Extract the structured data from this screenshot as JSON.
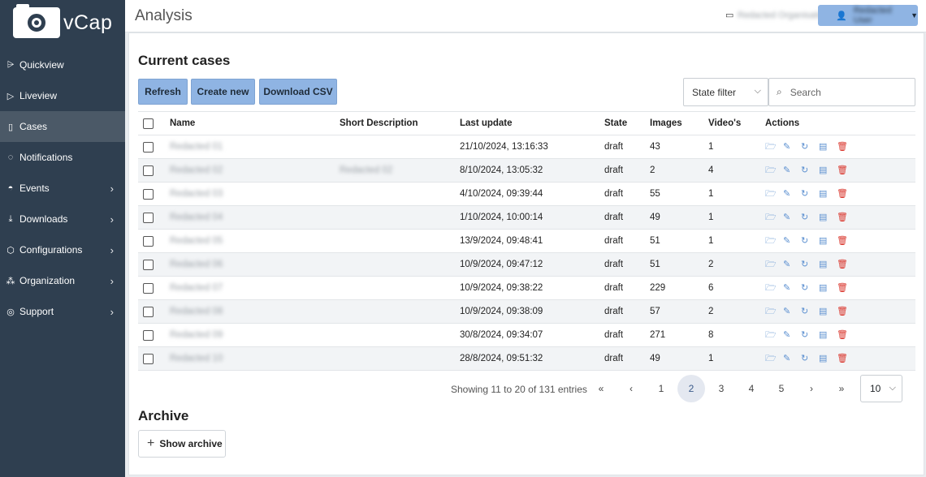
{
  "app": {
    "logo_text": "vCap"
  },
  "sidebar": {
    "items": [
      {
        "label": "Quickview",
        "icon": "⩥"
      },
      {
        "label": "Liveview",
        "icon": "▷"
      },
      {
        "label": "Cases",
        "icon": "▯"
      },
      {
        "label": "Notifications",
        "icon": "◌"
      },
      {
        "label": "Events",
        "icon": "◓"
      },
      {
        "label": "Downloads",
        "icon": "⤓"
      },
      {
        "label": "Configurations",
        "icon": "⬡"
      },
      {
        "label": "Organization",
        "icon": "⁂"
      },
      {
        "label": "Support",
        "icon": "◎"
      }
    ],
    "chevron": "›"
  },
  "header": {
    "title": "Analysis",
    "org_icon": "▭",
    "org_name": "Redacted Organisation",
    "user_icon": "👤",
    "user_name": "Redacted User",
    "caret": "▼"
  },
  "current": {
    "title": "Current cases",
    "refresh_label": "Refresh",
    "create_label": "Create new",
    "download_label": "Download CSV",
    "state_filter_label": "State filter",
    "search_placeholder": "Search",
    "columns": {
      "name": "Name",
      "short_description": "Short Description",
      "last_update": "Last update",
      "state": "State",
      "images": "Images",
      "videos": "Video's",
      "actions": "Actions"
    },
    "rows": [
      {
        "name": "Redacted 01",
        "short": "",
        "last_update": "21/10/2024, 13:16:33",
        "state": "draft",
        "images": "43",
        "videos": "1"
      },
      {
        "name": "Redacted 02",
        "short": "Redacted 02",
        "last_update": "8/10/2024, 13:05:32",
        "state": "draft",
        "images": "2",
        "videos": "4"
      },
      {
        "name": "Redacted 03",
        "short": "",
        "last_update": "4/10/2024, 09:39:44",
        "state": "draft",
        "images": "55",
        "videos": "1"
      },
      {
        "name": "Redacted 04",
        "short": "",
        "last_update": "1/10/2024, 10:00:14",
        "state": "draft",
        "images": "49",
        "videos": "1"
      },
      {
        "name": "Redacted 05",
        "short": "",
        "last_update": "13/9/2024, 09:48:41",
        "state": "draft",
        "images": "51",
        "videos": "1"
      },
      {
        "name": "Redacted 06",
        "short": "",
        "last_update": "10/9/2024, 09:47:12",
        "state": "draft",
        "images": "51",
        "videos": "2"
      },
      {
        "name": "Redacted 07",
        "short": "",
        "last_update": "10/9/2024, 09:38:22",
        "state": "draft",
        "images": "229",
        "videos": "6"
      },
      {
        "name": "Redacted 08",
        "short": "",
        "last_update": "10/9/2024, 09:38:09",
        "state": "draft",
        "images": "57",
        "videos": "2"
      },
      {
        "name": "Redacted 09",
        "short": "",
        "last_update": "30/8/2024, 09:34:07",
        "state": "draft",
        "images": "271",
        "videos": "8"
      },
      {
        "name": "Redacted 10",
        "short": "",
        "last_update": "28/8/2024, 09:51:32",
        "state": "draft",
        "images": "49",
        "videos": "1"
      }
    ],
    "action_icons": {
      "open": "🗁",
      "edit": "✎",
      "refresh": "↻",
      "archive": "▤",
      "delete": "🗑"
    }
  },
  "pagination": {
    "info": "Showing 11 to 20 of 131 entries",
    "first": "«",
    "prev": "‹",
    "pages": [
      "1",
      "2",
      "3",
      "4",
      "5"
    ],
    "current": "2",
    "next": "›",
    "last": "»",
    "per_page": "10"
  },
  "archive": {
    "title": "Archive",
    "show_label": "Show archive"
  }
}
